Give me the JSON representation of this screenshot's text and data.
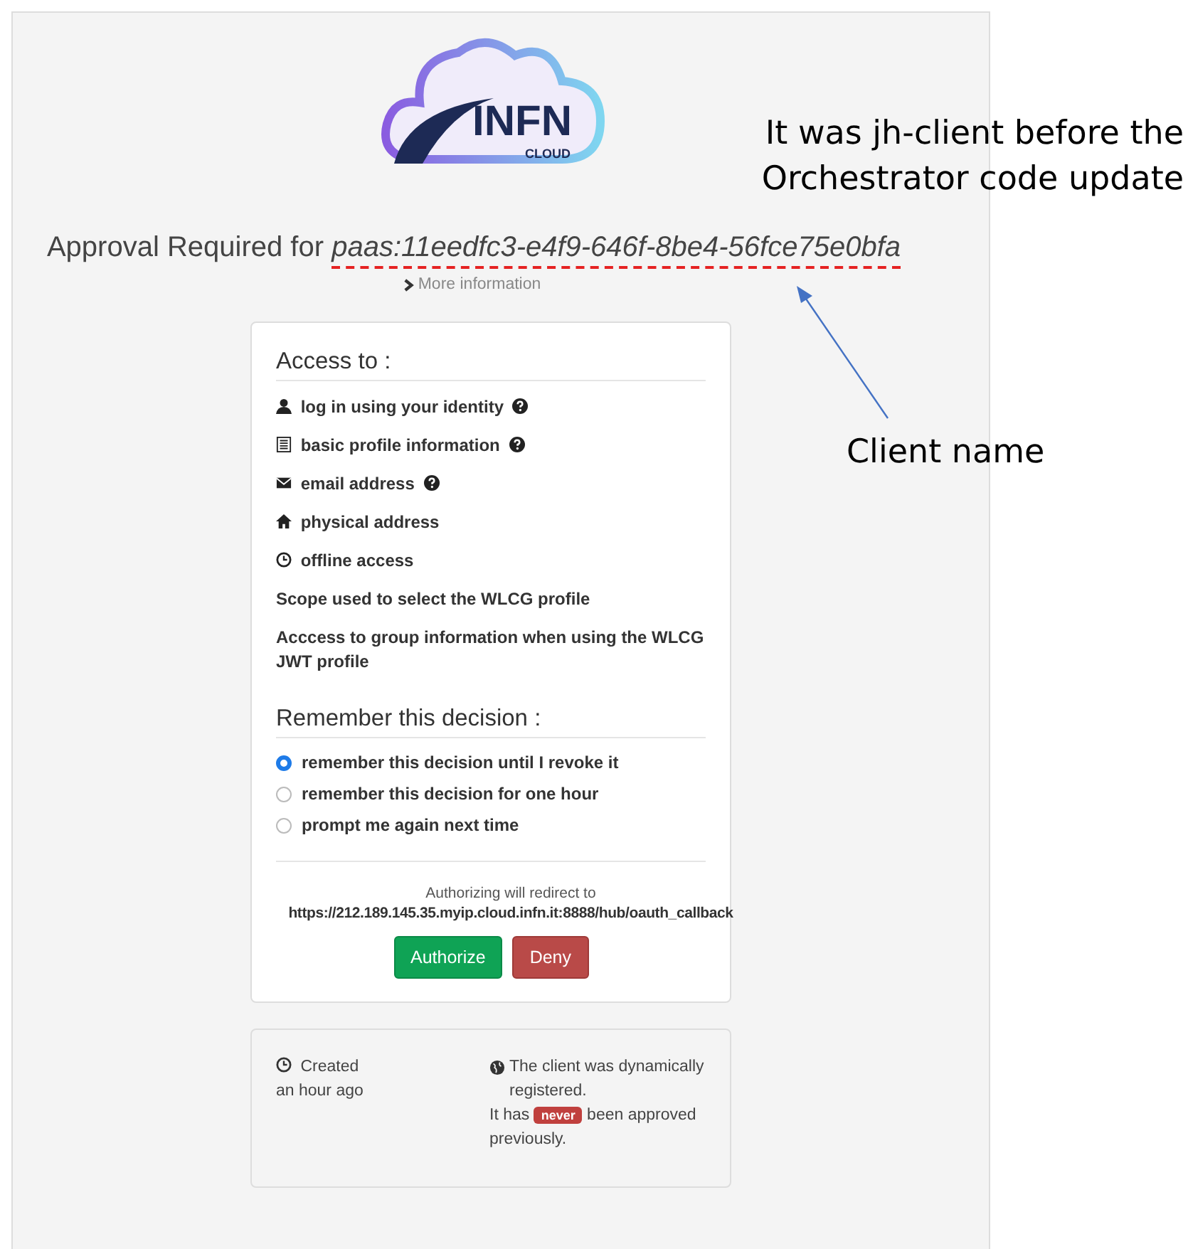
{
  "logo": {
    "text": "INFN",
    "subtext": "CLOUD"
  },
  "title": "Approval Required for *paas:11eedfc3-e4f9-646f-8be4-56fce75e0bfa*",
  "more_information": "More information",
  "access": {
    "heading": "Access to :",
    "scopes": [
      {
        "kind": "user",
        "label": "log in using your identity",
        "help": true
      },
      {
        "kind": "list",
        "label": "basic profile information",
        "help": true
      },
      {
        "kind": "envelope",
        "label": "email address",
        "help": true
      },
      {
        "kind": "home",
        "label": "physical address",
        "help": false
      },
      {
        "kind": "clock",
        "label": "offline access",
        "help": false
      },
      {
        "kind": "plain",
        "label": "Scope used to select the WLCG profile",
        "help": false
      },
      {
        "kind": "plain",
        "label": "Acccess to group information when using the WLCG JWT profile",
        "help": false
      }
    ]
  },
  "remember": {
    "heading": "Remember this decision :",
    "options": [
      {
        "label": "remember this decision until I revoke it",
        "selected": true
      },
      {
        "label": "remember this decision for one hour",
        "selected": false
      },
      {
        "label": "prompt me again next time",
        "selected": false
      }
    ]
  },
  "redirect": {
    "caption": "Authorizing will redirect to",
    "url": "https://212.189.145.35.myip.cloud.infn.it:8888/hub/oauth_callback"
  },
  "buttons": [
    {
      "kind": "authorize",
      "label": "Authorize"
    },
    {
      "kind": "deny",
      "label": "Deny"
    }
  ],
  "info": {
    "created_label": "Created",
    "created_value": "an hour ago",
    "registration": "The client was dynamically registered.",
    "approval_before": "It has",
    "approval_badge": "never",
    "approval_after": "been approved previously."
  },
  "annotations": [
    {
      "kind": "note",
      "text": "It was jh-client before the Orchestrator code update"
    },
    {
      "kind": "callout",
      "text": "Client name"
    }
  ]
}
